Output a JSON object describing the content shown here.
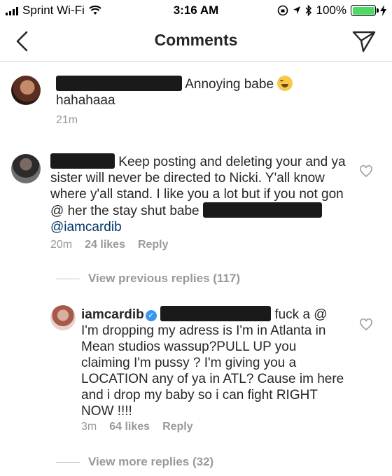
{
  "status_bar": {
    "carrier": "Sprint Wi-Fi",
    "time": "3:16 AM",
    "battery_percent": "100%",
    "battery_level": 1.0
  },
  "nav": {
    "title": "Comments"
  },
  "comments": [
    {
      "text": "Annoying babe",
      "text_cont": "hahahaaa",
      "time": "21m"
    },
    {
      "text_a": "Keep posting and deleting your and",
      "text_b": "ya sister will never be directed to Nicki. Y'all know where y'all stand. I like you a lot but if you not gon @ her the stay shut babe",
      "mention": "@iamcardib",
      "time": "20m",
      "likes": "24 likes",
      "reply": "Reply"
    },
    {
      "username": "iamcardib",
      "text_a": "fuck a @",
      "text_b": "I'm dropping my adress is I'm in Atlanta in Mean studios wassup?PULL UP you claiming I'm pussy ? I'm giving you a LOCATION any of ya in ATL? Cause im here and i drop my baby so i can fight RIGHT NOW !!!!",
      "time": "3m",
      "likes": "64 likes",
      "reply": "Reply"
    }
  ],
  "view_previous": "View previous replies (117)",
  "view_more": "View more replies (32)",
  "colors": {
    "text": "#262626",
    "muted": "#999999",
    "mention": "#003569",
    "verified": "#3897f0",
    "battery": "#4cd964"
  }
}
